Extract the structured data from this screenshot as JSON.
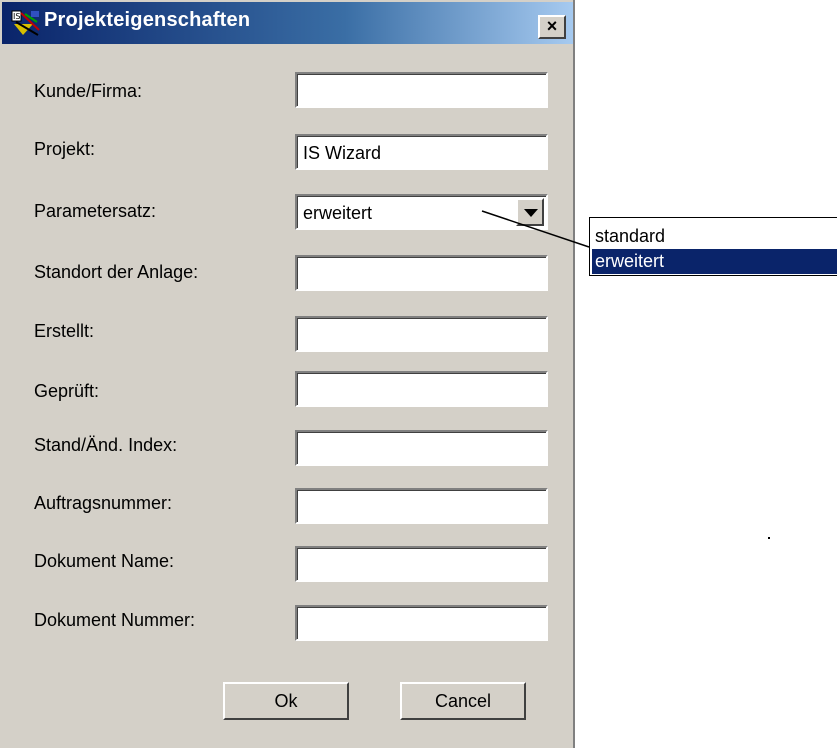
{
  "window": {
    "title": "Projekteigenschaften",
    "close_label": "×"
  },
  "fields": [
    {
      "label": "Kunde/Firma:",
      "value": ""
    },
    {
      "label": "Projekt:",
      "value": "IS Wizard"
    },
    {
      "label": "Parametersatz:",
      "value": "erweitert"
    },
    {
      "label": "Standort der Anlage:",
      "value": ""
    },
    {
      "label": "Erstellt:",
      "value": ""
    },
    {
      "label": "Geprüft:",
      "value": ""
    },
    {
      "label": "Stand/Änd. Index:",
      "value": ""
    },
    {
      "label": "Auftragsnummer:",
      "value": ""
    },
    {
      "label": "Dokument Name:",
      "value": ""
    },
    {
      "label": "Dokument Nummer:",
      "value": ""
    }
  ],
  "dropdown_options": [
    {
      "label": "standard",
      "selected": false
    },
    {
      "label": "erweitert",
      "selected": true
    }
  ],
  "buttons": {
    "ok": "Ok",
    "cancel": "Cancel"
  },
  "icons": {
    "app": "app-icon",
    "close": "close-icon",
    "dropdown": "chevron-down-icon"
  },
  "colors": {
    "titlebar_start": "#0a246a",
    "titlebar_end": "#a6caf0",
    "dialog_bg": "#d4d0c8",
    "selection_bg": "#0a246a"
  }
}
